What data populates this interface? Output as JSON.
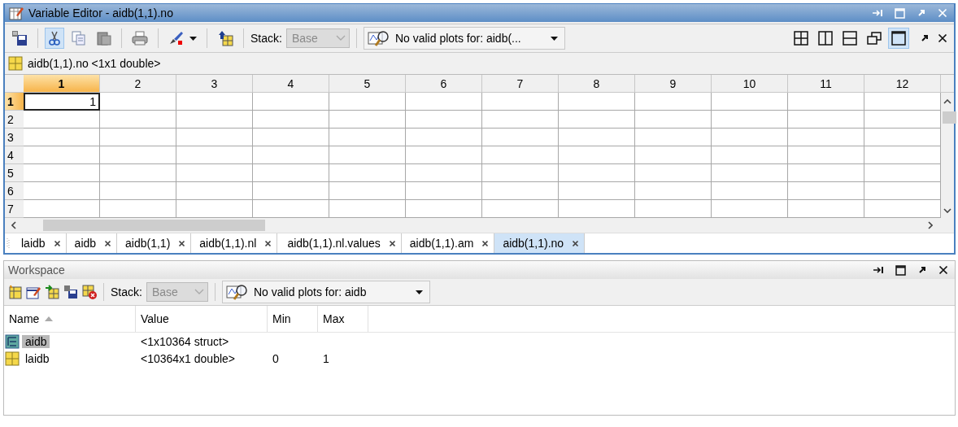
{
  "editor": {
    "title": "Variable Editor - aidb(1,1).no",
    "toolbar": {
      "stack_label": "Stack:",
      "stack_value": "Base",
      "plots": "No valid plots for: aidb(...",
      "layouts": [
        {
          "kind": "grid4",
          "selected": false
        },
        {
          "kind": "columns",
          "selected": false
        },
        {
          "kind": "rows",
          "selected": false
        },
        {
          "kind": "floating",
          "selected": false
        },
        {
          "kind": "single",
          "selected": true
        }
      ]
    },
    "variable_label": "aidb(1,1).no <1x1 double>",
    "grid": {
      "columns": [
        {
          "label": "1",
          "selected": true
        },
        {
          "label": "2",
          "selected": false
        },
        {
          "label": "3",
          "selected": false
        },
        {
          "label": "4",
          "selected": false
        },
        {
          "label": "5",
          "selected": false
        },
        {
          "label": "6",
          "selected": false
        },
        {
          "label": "7",
          "selected": false
        },
        {
          "label": "8",
          "selected": false
        },
        {
          "label": "9",
          "selected": false
        },
        {
          "label": "10",
          "selected": false
        },
        {
          "label": "11",
          "selected": false
        },
        {
          "label": "12",
          "selected": false
        }
      ],
      "rows": [
        {
          "label": "1",
          "selected": true,
          "cells": [
            "1"
          ]
        },
        {
          "label": "2",
          "selected": false
        },
        {
          "label": "3",
          "selected": false
        },
        {
          "label": "4",
          "selected": false
        },
        {
          "label": "5",
          "selected": false
        },
        {
          "label": "6",
          "selected": false
        },
        {
          "label": "7",
          "selected": false
        }
      ]
    },
    "tabs": [
      {
        "label": "laidb",
        "selected": false
      },
      {
        "label": "aidb",
        "selected": false
      },
      {
        "label": "aidb(1,1)",
        "selected": false
      },
      {
        "label": "aidb(1,1).nl",
        "selected": false
      },
      {
        "label": "aidb(1,1).nl.values",
        "selected": false
      },
      {
        "label": "aidb(1,1).am",
        "selected": false
      },
      {
        "label": "aidb(1,1).no",
        "selected": true
      }
    ]
  },
  "workspace": {
    "title": "Workspace",
    "toolbar": {
      "stack_label": "Stack:",
      "stack_value": "Base",
      "plots": "No valid plots for: aidb"
    },
    "columns": [
      "Name",
      "Value",
      "Min",
      "Max"
    ],
    "rows": [
      {
        "kind": "struct",
        "name": "aidb",
        "value": "<1x10364 struct>",
        "selected": true
      },
      {
        "kind": "double",
        "name": "laidb",
        "value": "<10364x1 double>",
        "min": "0",
        "max": "1",
        "selected": false
      }
    ]
  }
}
